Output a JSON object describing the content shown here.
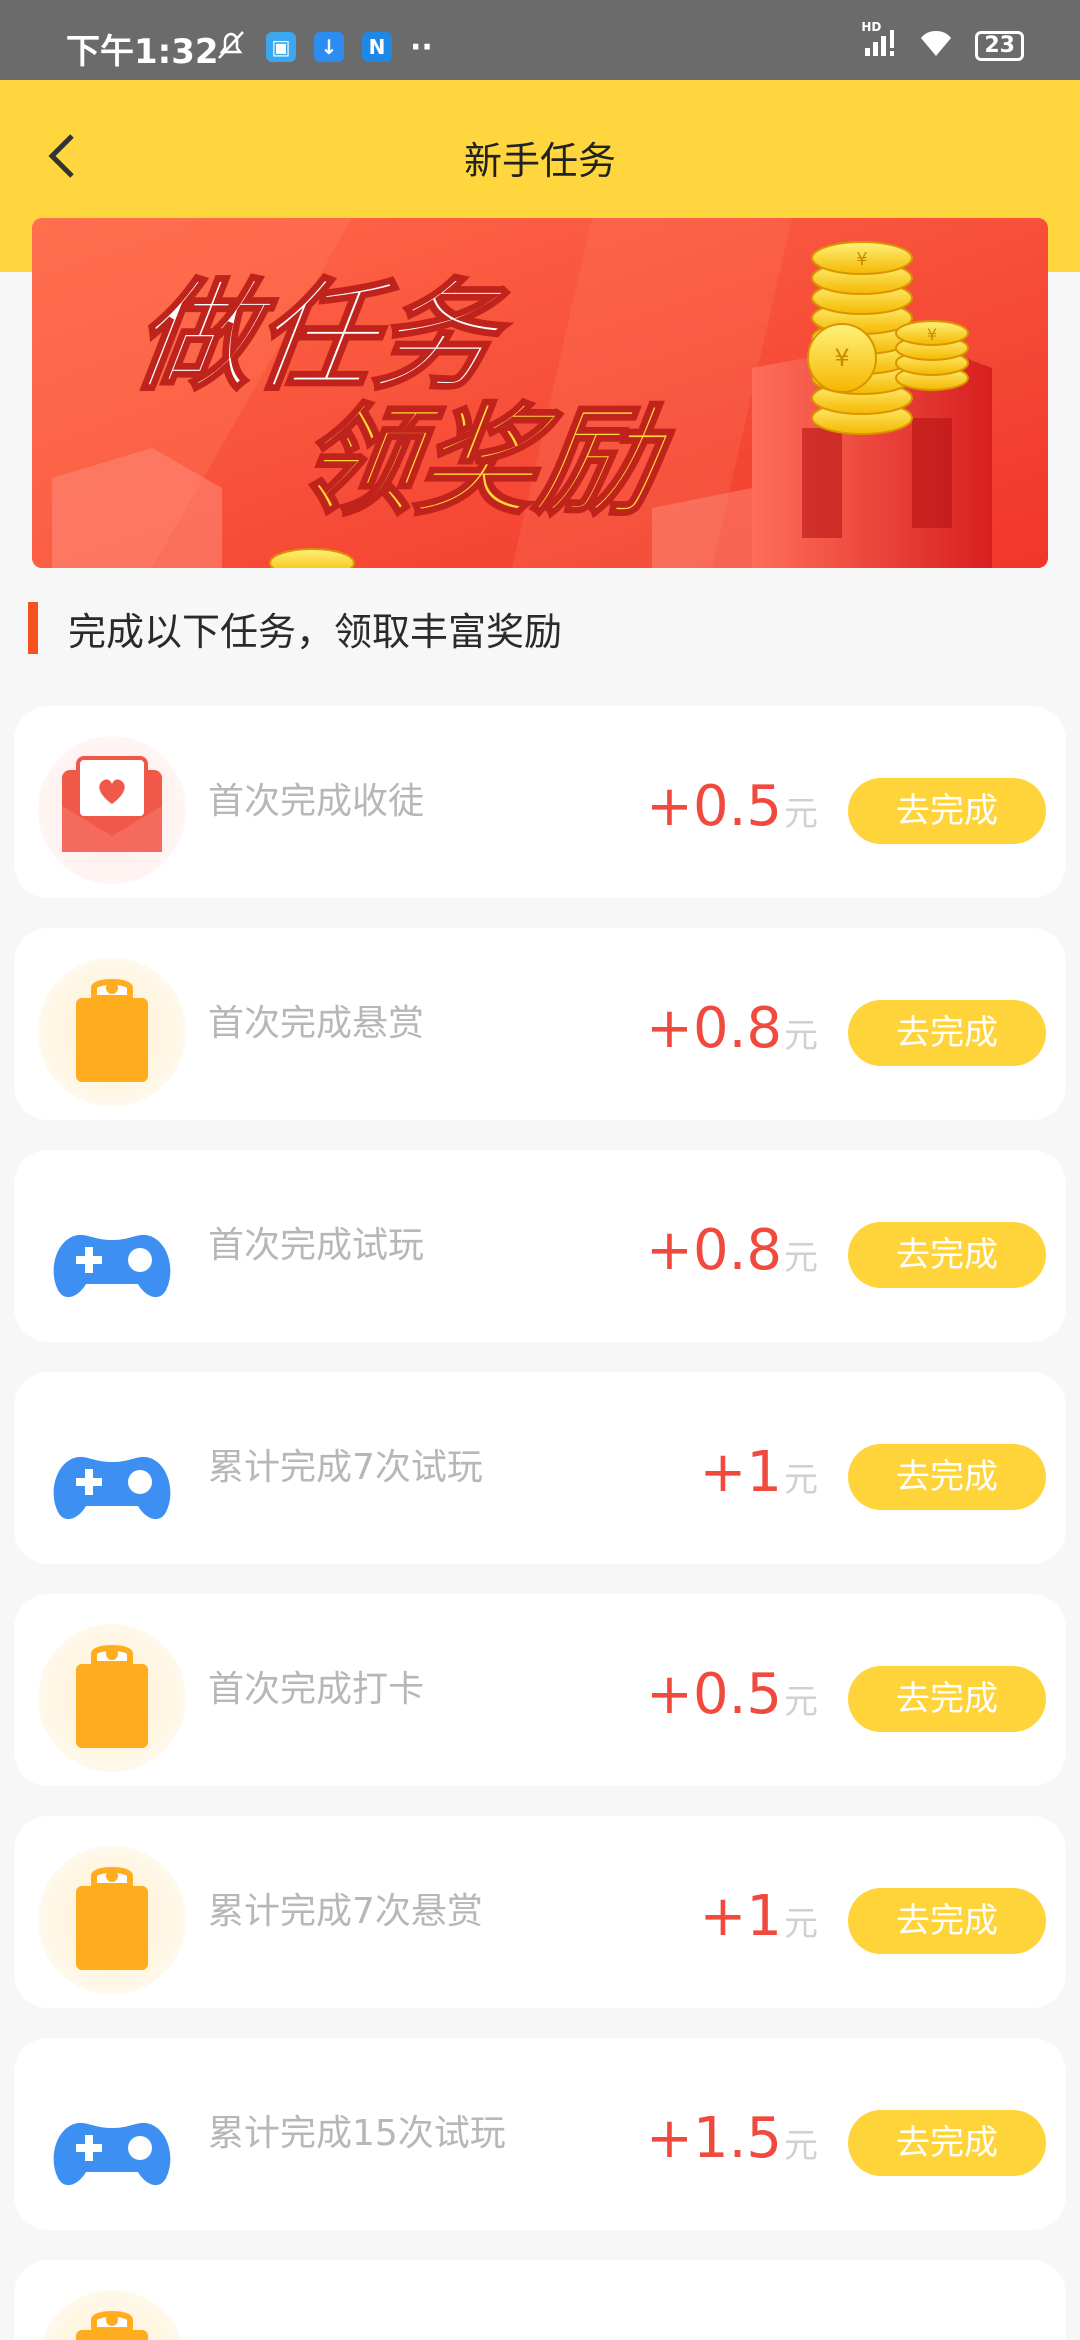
{
  "status_bar": {
    "time": "下午1:32",
    "hd": "HD",
    "battery": "23",
    "more": "··"
  },
  "header": {
    "title": "新手任务"
  },
  "banner": {
    "line1": "做任务",
    "line2": "领奖励"
  },
  "section": {
    "heading": "完成以下任务，领取丰富奖励"
  },
  "tasks": [
    {
      "label": "首次完成收徒",
      "amount": "+0.5",
      "unit": "元",
      "button": "去完成",
      "icon": "envelope-heart-icon"
    },
    {
      "label": "首次完成悬赏",
      "amount": "+0.8",
      "unit": "元",
      "button": "去完成",
      "icon": "clipboard-icon"
    },
    {
      "label": "首次完成试玩",
      "amount": "+0.8",
      "unit": "元",
      "button": "去完成",
      "icon": "gamepad-icon"
    },
    {
      "label": "累计完成7次试玩",
      "amount": "+1",
      "unit": "元",
      "button": "去完成",
      "icon": "gamepad-icon"
    },
    {
      "label": "首次完成打卡",
      "amount": "+0.5",
      "unit": "元",
      "button": "去完成",
      "icon": "clipboard-icon"
    },
    {
      "label": "累计完成7次悬赏",
      "amount": "+1",
      "unit": "元",
      "button": "去完成",
      "icon": "clipboard-icon"
    },
    {
      "label": "累计完成15次试玩",
      "amount": "+1.5",
      "unit": "元",
      "button": "去完成",
      "icon": "gamepad-icon"
    }
  ],
  "colors": {
    "header": "#ffd63e",
    "accent_red": "#f04a3e",
    "button": "#ffd43a"
  }
}
